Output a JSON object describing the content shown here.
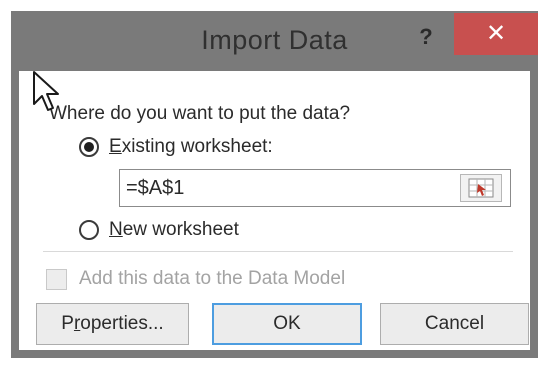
{
  "dialog": {
    "title": "Import Data",
    "help_label": "?",
    "close_label": "✕",
    "prompt": "Where do you want to put the data?",
    "options": {
      "existing": {
        "pre": "",
        "key": "E",
        "post": "xisting worksheet:",
        "selected": true
      },
      "new": {
        "pre": "",
        "key": "N",
        "post": "ew worksheet",
        "selected": false
      }
    },
    "reference_value": "=$A$1",
    "data_model_label": "Add this data to the Data Model",
    "data_model_checked": false,
    "data_model_enabled": false,
    "buttons": {
      "properties": {
        "pre": "P",
        "key": "r",
        "post": "operties..."
      },
      "ok": "OK",
      "cancel": "Cancel"
    }
  },
  "colors": {
    "close_button": "#c8504f",
    "frame": "#7a7a7a",
    "default_button_border": "#4d9de0"
  }
}
